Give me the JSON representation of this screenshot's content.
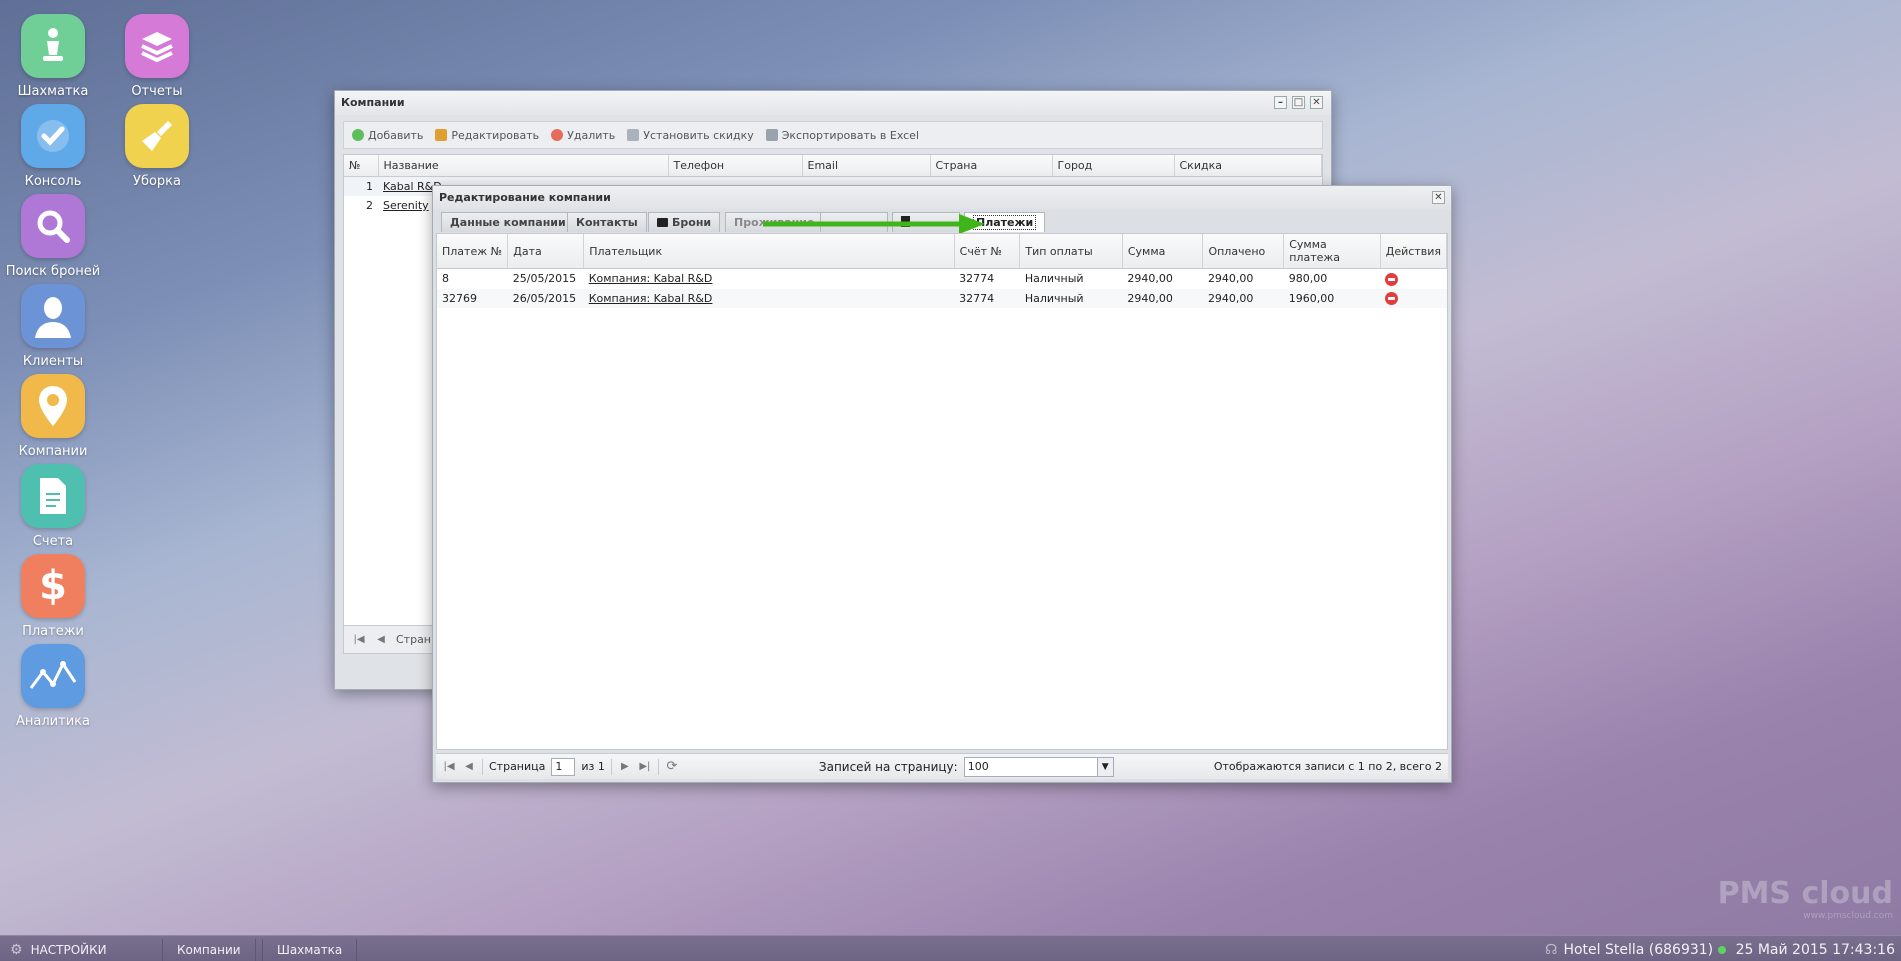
{
  "desktop": {
    "icons": [
      {
        "label": "Шахматка",
        "icon": "chess-pawn-icon",
        "color": "#6fcf97"
      },
      {
        "label": "Отчеты",
        "icon": "stack-icon",
        "color": "#d67ad8"
      },
      {
        "label": "Консоль",
        "icon": "checkmark-icon",
        "color": "#5fa9e8"
      },
      {
        "label": "Уборка",
        "icon": "broom-icon",
        "color": "#f0d24f"
      },
      {
        "label": "Поиск броней",
        "icon": "magnifier-icon",
        "color": "#b078d6"
      },
      {
        "label": "Клиенты",
        "icon": "person-icon",
        "color": "#6b93d6"
      },
      {
        "label": "Компании",
        "icon": "location-pin-icon",
        "color": "#f0b94a"
      },
      {
        "label": "Счета",
        "icon": "document-icon",
        "color": "#4fbfb0"
      },
      {
        "label": "Платежи",
        "icon": "dollar-icon",
        "color": "#ef7f5f"
      },
      {
        "label": "Аналитика",
        "icon": "line-chart-icon",
        "color": "#5e9be0"
      }
    ]
  },
  "companies_window": {
    "title": "Компании",
    "toolbar": {
      "add": "Добавить",
      "edit": "Редактировать",
      "delete": "Удалить",
      "discount": "Установить скидку",
      "export": "Экспортировать в Excel"
    },
    "columns": [
      "№",
      "Название",
      "Телефон",
      "Email",
      "Страна",
      "Город",
      "Скидка"
    ],
    "rows": [
      {
        "num": "1",
        "name": "Kabal R&D"
      },
      {
        "num": "2",
        "name": "Serenity"
      }
    ],
    "pager_label": "Стран"
  },
  "edit_window": {
    "title": "Редактирование компании",
    "tabs": {
      "data": "Данные компании",
      "contacts": "Контакты",
      "bookings": "Брони",
      "stays": "Проживание",
      "payments": "Платежи"
    },
    "columns": [
      "Платеж №",
      "Дата",
      "Плательщик",
      "Счёт №",
      "Тип оплаты",
      "Сумма",
      "Оплачено",
      "Сумма платежа",
      "Действия"
    ],
    "rows": [
      {
        "id": "8",
        "date": "25/05/2015",
        "payer": "Компания: Kabal R&D",
        "invoice": "32774",
        "type": "Наличный",
        "sum": "2940,00",
        "paid": "2940,00",
        "payment": "980,00"
      },
      {
        "id": "32769",
        "date": "26/05/2015",
        "payer": "Компания: Kabal R&D",
        "invoice": "32774",
        "type": "Наличный",
        "sum": "2940,00",
        "paid": "2940,00",
        "payment": "1960,00"
      }
    ],
    "pager": {
      "page_label": "Страница",
      "page_value": "1",
      "of_label": "из 1",
      "per_page_label": "Записей на страницу:",
      "per_page_value": "100",
      "summary": "Отображаются записи с 1 по 2, всего 2"
    }
  },
  "watermark": {
    "brand": "PMS cloud",
    "url": "www.pmscloud.com"
  },
  "taskbar": {
    "settings": "НАСТРОЙКИ",
    "task1": "Компании",
    "task2": "Шахматка",
    "hotel": "Hotel Stella (686931)",
    "datetime": "25 Май 2015 17:43:16"
  },
  "colors": {
    "arrow": "#3fb51a",
    "delete": "#e23c3c",
    "online": "#5fd35f"
  }
}
